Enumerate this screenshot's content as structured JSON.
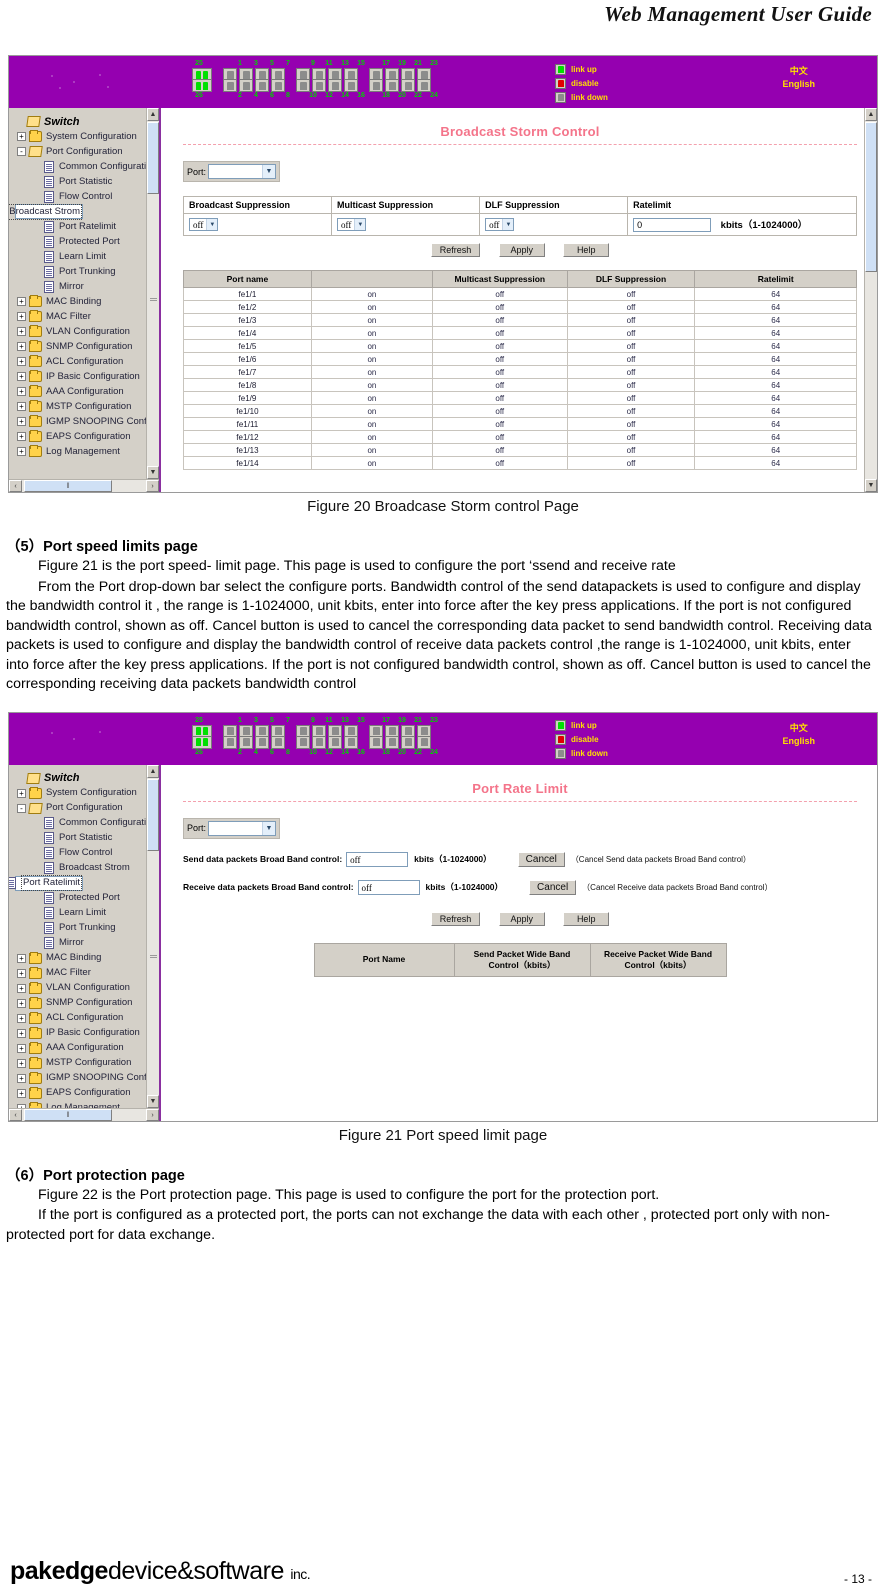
{
  "document": {
    "header_title": "Web Management User Guide",
    "footer_brand_bold": "pakedge",
    "footer_brand_mid": "device&software",
    "footer_brand_small": "inc.",
    "page_number": "- 13 -"
  },
  "switch_banner": {
    "top_port_numbers": [
      "1",
      "3",
      "5",
      "7",
      "9",
      "11",
      "13",
      "15",
      "17",
      "19",
      "21",
      "23"
    ],
    "bottom_port_numbers": [
      "2",
      "4",
      "6",
      "8",
      "10",
      "12",
      "14",
      "16",
      "18",
      "20",
      "22",
      "24"
    ],
    "uplink_top_label": "25",
    "uplink_bottom_label": "26",
    "legend": [
      {
        "label": "link up",
        "color": "#00e000",
        "state": "green"
      },
      {
        "label": "disable",
        "color": "#e00000",
        "state": "red"
      },
      {
        "label": "link down",
        "color": "#8c8c8c",
        "state": "gray"
      }
    ],
    "languages": [
      {
        "label": "中文"
      },
      {
        "label": "English"
      }
    ],
    "banner_color": "#9500b0",
    "label_color": "#ffe000"
  },
  "sidebar": {
    "root_label": "Switch",
    "items": [
      {
        "label": "System Configuration",
        "level": 1,
        "type": "folder",
        "expander": "+"
      },
      {
        "label": "Port Configuration",
        "level": 1,
        "type": "folder-open",
        "expander": "-"
      },
      {
        "label": "Common Configuration",
        "level": 2,
        "type": "page",
        "expander": ""
      },
      {
        "label": "Port Statistic",
        "level": 2,
        "type": "page",
        "expander": ""
      },
      {
        "label": "Flow Control",
        "level": 2,
        "type": "page",
        "expander": ""
      },
      {
        "label": "Broadcast Strom",
        "level": 2,
        "type": "page",
        "expander": ""
      },
      {
        "label": "Port Ratelimit",
        "level": 2,
        "type": "page",
        "expander": ""
      },
      {
        "label": "Protected Port",
        "level": 2,
        "type": "page",
        "expander": ""
      },
      {
        "label": "Learn Limit",
        "level": 2,
        "type": "page",
        "expander": ""
      },
      {
        "label": "Port Trunking",
        "level": 2,
        "type": "page",
        "expander": ""
      },
      {
        "label": "Mirror",
        "level": 2,
        "type": "page",
        "expander": ""
      },
      {
        "label": "MAC Binding",
        "level": 1,
        "type": "folder",
        "expander": "+"
      },
      {
        "label": "MAC Filter",
        "level": 1,
        "type": "folder",
        "expander": "+"
      },
      {
        "label": "VLAN Configuration",
        "level": 1,
        "type": "folder",
        "expander": "+"
      },
      {
        "label": "SNMP Configuration",
        "level": 1,
        "type": "folder",
        "expander": "+"
      },
      {
        "label": "ACL Configuration",
        "level": 1,
        "type": "folder",
        "expander": "+"
      },
      {
        "label": "IP Basic Configuration",
        "level": 1,
        "type": "folder",
        "expander": "+"
      },
      {
        "label": "AAA Configuration",
        "level": 1,
        "type": "folder",
        "expander": "+"
      },
      {
        "label": "MSTP Configuration",
        "level": 1,
        "type": "folder",
        "expander": "+"
      },
      {
        "label": "IGMP SNOOPING Config",
        "level": 1,
        "type": "folder",
        "expander": "+"
      },
      {
        "label": "EAPS Configuration",
        "level": 1,
        "type": "folder",
        "expander": "+"
      },
      {
        "label": "Log Management",
        "level": 1,
        "type": "folder",
        "expander": "+"
      }
    ],
    "selected_fig20": "Broadcast Strom",
    "selected_fig21": "Port Ratelimit"
  },
  "broadcast_storm_page": {
    "title": "Broadcast Storm Control",
    "port_label": "Port:",
    "port_value": "",
    "config_headers": [
      "Broadcast Suppression",
      "Multicast Suppression",
      "DLF Suppression",
      "Ratelimit"
    ],
    "broadcast_value": "off",
    "multicast_value": "off",
    "dlf_value": "off",
    "ratelimit_value": "0",
    "ratelimit_unit": "kbits（1-1024000）",
    "buttons": [
      "Refresh",
      "Apply",
      "Help"
    ],
    "table_headers": [
      "Port name",
      "",
      "Multicast Suppression",
      "DLF Suppression",
      "Ratelimit"
    ],
    "rows": [
      {
        "port": "fe1/1",
        "broadcast": "on",
        "multicast": "off",
        "dlf": "off",
        "ratelimit": "64"
      },
      {
        "port": "fe1/2",
        "broadcast": "on",
        "multicast": "off",
        "dlf": "off",
        "ratelimit": "64"
      },
      {
        "port": "fe1/3",
        "broadcast": "on",
        "multicast": "off",
        "dlf": "off",
        "ratelimit": "64"
      },
      {
        "port": "fe1/4",
        "broadcast": "on",
        "multicast": "off",
        "dlf": "off",
        "ratelimit": "64"
      },
      {
        "port": "fe1/5",
        "broadcast": "on",
        "multicast": "off",
        "dlf": "off",
        "ratelimit": "64"
      },
      {
        "port": "fe1/6",
        "broadcast": "on",
        "multicast": "off",
        "dlf": "off",
        "ratelimit": "64"
      },
      {
        "port": "fe1/7",
        "broadcast": "on",
        "multicast": "off",
        "dlf": "off",
        "ratelimit": "64"
      },
      {
        "port": "fe1/8",
        "broadcast": "on",
        "multicast": "off",
        "dlf": "off",
        "ratelimit": "64"
      },
      {
        "port": "fe1/9",
        "broadcast": "on",
        "multicast": "off",
        "dlf": "off",
        "ratelimit": "64"
      },
      {
        "port": "fe1/10",
        "broadcast": "on",
        "multicast": "off",
        "dlf": "off",
        "ratelimit": "64"
      },
      {
        "port": "fe1/11",
        "broadcast": "on",
        "multicast": "off",
        "dlf": "off",
        "ratelimit": "64"
      },
      {
        "port": "fe1/12",
        "broadcast": "on",
        "multicast": "off",
        "dlf": "off",
        "ratelimit": "64"
      },
      {
        "port": "fe1/13",
        "broadcast": "on",
        "multicast": "off",
        "dlf": "off",
        "ratelimit": "64"
      },
      {
        "port": "fe1/14",
        "broadcast": "on",
        "multicast": "off",
        "dlf": "off",
        "ratelimit": "64"
      }
    ]
  },
  "port_rate_limit_page": {
    "title": "Port Rate Limit",
    "port_label": "Port:",
    "port_value": "",
    "send_label": "Send data packets Broad Band control:",
    "send_value": "off",
    "send_range": "kbits（1-1024000）",
    "send_cancel_btn": "Cancel",
    "send_cancel_note": "（Cancel Send data packets Broad Band control）",
    "recv_label": "Receive data packets Broad Band control:",
    "recv_value": "off",
    "recv_range": "kbits（1-1024000）",
    "recv_cancel_btn": "Cancel",
    "recv_cancel_note": "（Cancel Receive data packets Broad Band control）",
    "buttons": [
      "Refresh",
      "Apply",
      "Help"
    ],
    "table_headers": [
      "Port Name",
      "Send Packet Wide Band Control（kbits）",
      "Receive Packet Wide Band Control（kbits）"
    ]
  },
  "captions": {
    "figure20": "Figure 20 Broadcase Storm control Page",
    "figure21": "Figure 21 Port speed limit page"
  },
  "prose": {
    "section5_heading": "（5）Port speed limits page",
    "section5_p1": "Figure 21 is the port speed- limit page. This page is used to configure the port ‘ssend and receive rate",
    "section5_p2": "From the Port drop-down bar select the configure ports. Bandwidth control of the send datapackets is used to configure and display the bandwidth control it , the range is 1-1024000, unit kbits, enter into force after the key press applications. If the port is not configured bandwidth control, shown as off. Cancel button is used to cancel the corresponding data packet to send bandwidth control. Receiving data packets is used to configure and display the bandwidth control of receive data packets control ,the range is 1-1024000, unit kbits, enter into force after the key press applications. If the port is not configured bandwidth control, shown as off. Cancel button is used to cancel the corresponding receiving data packets bandwidth control",
    "section6_heading": "（6）Port protection page",
    "section6_p1": "Figure 22 is the Port protection page. This page is used to configure the port for the protection port.",
    "section6_p2": "If the port is configured as a protected port, the ports can not exchange the data with each other , protected port only with non-protected port for data exchange."
  },
  "scroll": {
    "left_arrow": "‹",
    "right_arrow": "›",
    "up_arrow": "▲",
    "down_arrow": "▼",
    "grip": "‖"
  }
}
